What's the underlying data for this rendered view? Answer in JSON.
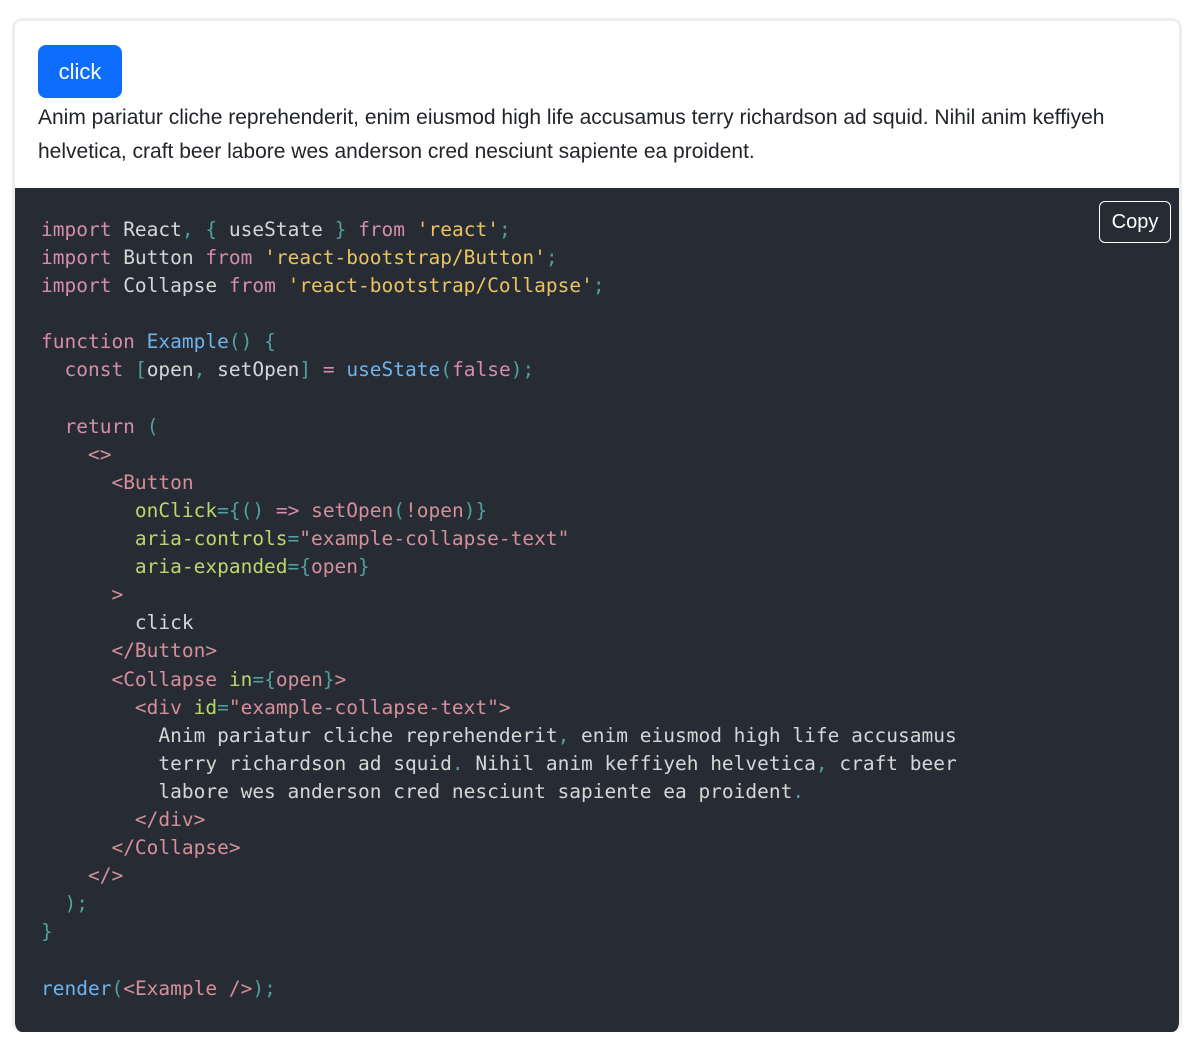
{
  "preview": {
    "button_label": "click",
    "collapse_text": "Anim pariatur cliche reprehenderit, enim eiusmod high life accusamus terry richardson ad squid. Nihil anim keffiyeh helvetica, craft beer labore wes anderson cred nesciunt sapiente ea proident."
  },
  "code": {
    "copy_label": "Copy",
    "lines": [
      [
        [
          "kw",
          "import"
        ],
        [
          "id",
          " React"
        ],
        [
          "punc",
          ","
        ],
        [
          "id",
          " "
        ],
        [
          "punc",
          "{"
        ],
        [
          "id",
          " useState "
        ],
        [
          "punc",
          "}"
        ],
        [
          "id",
          " "
        ],
        [
          "kw",
          "from"
        ],
        [
          "id",
          " "
        ],
        [
          "str",
          "'react'"
        ],
        [
          "punc",
          ";"
        ]
      ],
      [
        [
          "kw",
          "import"
        ],
        [
          "id",
          " Button "
        ],
        [
          "kw",
          "from"
        ],
        [
          "id",
          " "
        ],
        [
          "str",
          "'react-bootstrap/Button'"
        ],
        [
          "punc",
          ";"
        ]
      ],
      [
        [
          "kw",
          "import"
        ],
        [
          "id",
          " Collapse "
        ],
        [
          "kw",
          "from"
        ],
        [
          "id",
          " "
        ],
        [
          "str",
          "'react-bootstrap/Collapse'"
        ],
        [
          "punc",
          ";"
        ]
      ],
      [],
      [
        [
          "kw",
          "function"
        ],
        [
          "id",
          " "
        ],
        [
          "fn",
          "Example"
        ],
        [
          "punc",
          "()"
        ],
        [
          "id",
          " "
        ],
        [
          "punc",
          "{"
        ]
      ],
      [
        [
          "id",
          "  "
        ],
        [
          "kw",
          "const"
        ],
        [
          "id",
          " "
        ],
        [
          "punc",
          "["
        ],
        [
          "id",
          "open"
        ],
        [
          "punc",
          ","
        ],
        [
          "id",
          " setOpen"
        ],
        [
          "punc",
          "]"
        ],
        [
          "id",
          " "
        ],
        [
          "kw",
          "="
        ],
        [
          "id",
          " "
        ],
        [
          "fn",
          "useState"
        ],
        [
          "punc",
          "("
        ],
        [
          "kw",
          "false"
        ],
        [
          "punc",
          ");"
        ]
      ],
      [],
      [
        [
          "id",
          "  "
        ],
        [
          "kw",
          "return"
        ],
        [
          "id",
          " "
        ],
        [
          "punc",
          "("
        ]
      ],
      [
        [
          "id",
          "    "
        ],
        [
          "tag",
          "<>"
        ]
      ],
      [
        [
          "id",
          "      "
        ],
        [
          "tag",
          "<Button"
        ]
      ],
      [
        [
          "id",
          "        "
        ],
        [
          "attr",
          "onClick"
        ],
        [
          "punc",
          "="
        ],
        [
          "punc",
          "{"
        ],
        [
          "punc",
          "()"
        ],
        [
          "id",
          " "
        ],
        [
          "kw",
          "=>"
        ],
        [
          "id",
          " "
        ],
        [
          "tag",
          "setOpen"
        ],
        [
          "punc",
          "("
        ],
        [
          "tag",
          "!open"
        ],
        [
          "punc",
          ")"
        ],
        [
          "punc",
          "}"
        ]
      ],
      [
        [
          "id",
          "        "
        ],
        [
          "attr",
          "aria-controls"
        ],
        [
          "punc",
          "="
        ],
        [
          "aval",
          "\"example-collapse-text\""
        ]
      ],
      [
        [
          "id",
          "        "
        ],
        [
          "attr",
          "aria-expanded"
        ],
        [
          "punc",
          "="
        ],
        [
          "punc",
          "{"
        ],
        [
          "tag",
          "open"
        ],
        [
          "punc",
          "}"
        ]
      ],
      [
        [
          "id",
          "      "
        ],
        [
          "tag",
          ">"
        ]
      ],
      [
        [
          "id",
          "        click"
        ]
      ],
      [
        [
          "id",
          "      "
        ],
        [
          "tag",
          "</Button>"
        ]
      ],
      [
        [
          "id",
          "      "
        ],
        [
          "tag",
          "<Collapse"
        ],
        [
          "id",
          " "
        ],
        [
          "attr",
          "in"
        ],
        [
          "punc",
          "="
        ],
        [
          "punc",
          "{"
        ],
        [
          "tag",
          "open"
        ],
        [
          "punc",
          "}"
        ],
        [
          "tag",
          ">"
        ]
      ],
      [
        [
          "id",
          "        "
        ],
        [
          "tag",
          "<div"
        ],
        [
          "id",
          " "
        ],
        [
          "attr",
          "id"
        ],
        [
          "punc",
          "="
        ],
        [
          "aval",
          "\"example-collapse-text\""
        ],
        [
          "tag",
          ">"
        ]
      ],
      [
        [
          "id",
          "          Anim pariatur cliche reprehenderit"
        ],
        [
          "punc",
          ","
        ],
        [
          "id",
          " enim eiusmod high life accusamus"
        ]
      ],
      [
        [
          "id",
          "          terry richardson ad squid"
        ],
        [
          "punc",
          "."
        ],
        [
          "id",
          " Nihil anim keffiyeh helvetica"
        ],
        [
          "punc",
          ","
        ],
        [
          "id",
          " craft beer"
        ]
      ],
      [
        [
          "id",
          "          labore wes anderson cred nesciunt sapiente ea proident"
        ],
        [
          "punc",
          "."
        ]
      ],
      [
        [
          "id",
          "        "
        ],
        [
          "tag",
          "</div>"
        ]
      ],
      [
        [
          "id",
          "      "
        ],
        [
          "tag",
          "</Collapse>"
        ]
      ],
      [
        [
          "id",
          "    "
        ],
        [
          "tag",
          "</>"
        ]
      ],
      [
        [
          "id",
          "  "
        ],
        [
          "punc",
          ");"
        ]
      ],
      [
        [
          "punc",
          "}"
        ]
      ],
      [],
      [
        [
          "fn",
          "render"
        ],
        [
          "punc",
          "("
        ],
        [
          "tag",
          "<Example />"
        ],
        [
          "punc",
          ");"
        ]
      ]
    ]
  }
}
